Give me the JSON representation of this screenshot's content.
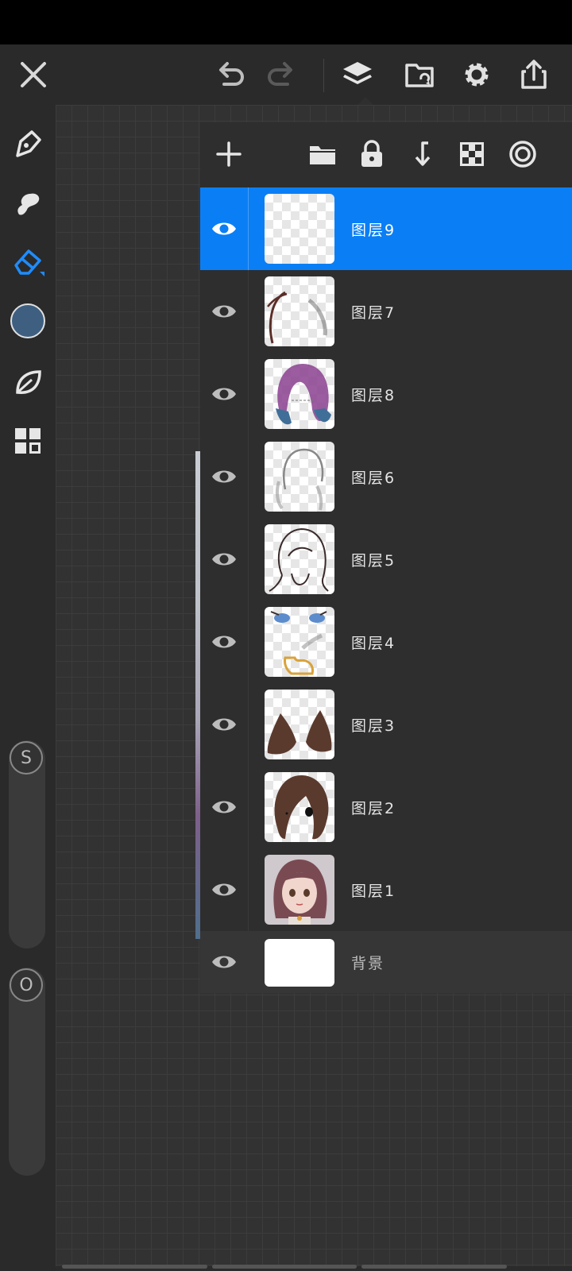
{
  "top_bar": {
    "close": "close-icon",
    "undo": "undo-icon",
    "redo": "redo-icon",
    "layers": "layers-icon",
    "gallery": "gallery-icon",
    "settings": "gear-icon",
    "share": "share-icon"
  },
  "left_toolbar": {
    "tools": [
      "pen-icon",
      "smudge-icon",
      "eraser-icon",
      "color-swatch",
      "leaf-icon",
      "grid-icon"
    ],
    "brush_color": "#3e5f80",
    "size_slider_label": "S",
    "opacity_slider_label": "O"
  },
  "layers_toolbar": {
    "buttons": [
      "add-icon",
      "folder-icon",
      "lock-icon",
      "merge-down-icon",
      "transparency-icon",
      "target-icon"
    ]
  },
  "layers": [
    {
      "name": "图层9",
      "selected": true
    },
    {
      "name": "图层7"
    },
    {
      "name": "图层8"
    },
    {
      "name": "图层6"
    },
    {
      "name": "图层5"
    },
    {
      "name": "图层4"
    },
    {
      "name": "图层3"
    },
    {
      "name": "图层2"
    },
    {
      "name": "图层1"
    }
  ],
  "background_layer": {
    "name": "背景"
  },
  "accent_color": "#0a7ff5"
}
